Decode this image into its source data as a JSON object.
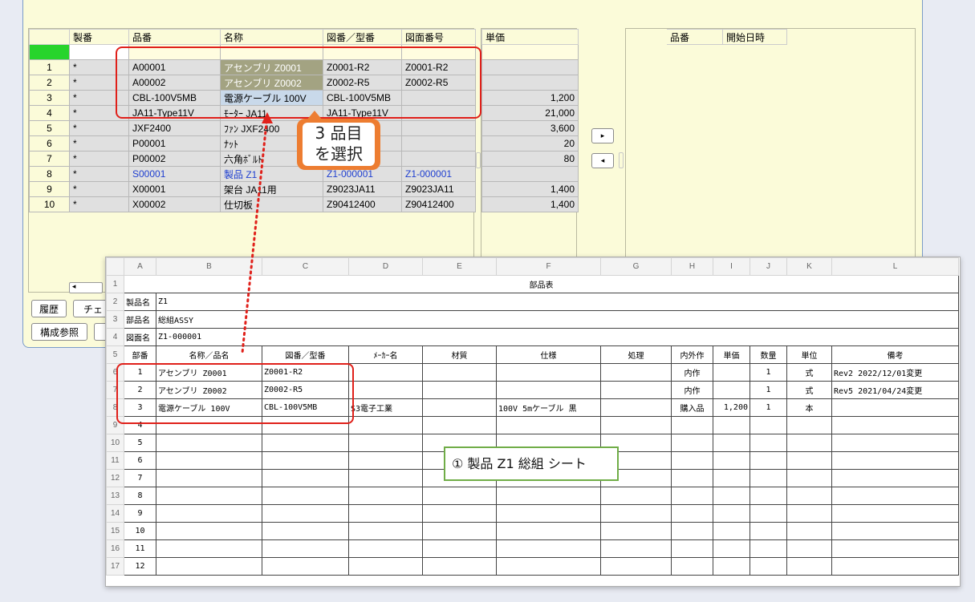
{
  "app": {
    "left_headers": [
      "製番",
      "品番",
      "名称",
      "図番／型番",
      "図面番号"
    ],
    "price_header": "単価",
    "right_headers": [
      "品番",
      "開始日時"
    ],
    "rows": [
      {
        "no": "1",
        "mark": "*",
        "code": "A00001",
        "name": "アセンブリ Z0001",
        "drawing": "Z0001-R2",
        "fig": "Z0001-R2",
        "price": ""
      },
      {
        "no": "2",
        "mark": "*",
        "code": "A00002",
        "name": "アセンブリ Z0002",
        "drawing": "Z0002-R5",
        "fig": "Z0002-R5",
        "price": ""
      },
      {
        "no": "3",
        "mark": "*",
        "code": "CBL-100V5MB",
        "name": "電源ケーブル 100V",
        "drawing": "CBL-100V5MB",
        "fig": "",
        "price": "1,200"
      },
      {
        "no": "4",
        "mark": "*",
        "code": "JA11-Type11V",
        "name": "ﾓｰﾀｰ JA11",
        "drawing": "JA11-Type11V",
        "fig": "",
        "price": "21,000"
      },
      {
        "no": "5",
        "mark": "*",
        "code": "JXF2400",
        "name": "ﾌｧﾝ JXF2400",
        "drawing": "",
        "fig": "",
        "price": "3,600"
      },
      {
        "no": "6",
        "mark": "*",
        "code": "P00001",
        "name": "ﾅｯﾄ",
        "drawing": "",
        "fig": "",
        "price": "20"
      },
      {
        "no": "7",
        "mark": "*",
        "code": "P00002",
        "name": "六角ﾎﾞﾙﾄ",
        "drawing": "",
        "fig": "",
        "price": "80"
      },
      {
        "no": "8",
        "mark": "*",
        "code": "S00001",
        "name": "製品 Z1",
        "drawing": "Z1-000001",
        "fig": "Z1-000001",
        "price": ""
      },
      {
        "no": "9",
        "mark": "*",
        "code": "X00001",
        "name": "架台 JA11用",
        "drawing": "Z9023JA11",
        "fig": "Z9023JA11",
        "price": "1,400"
      },
      {
        "no": "10",
        "mark": "*",
        "code": "X00002",
        "name": "仕切板",
        "drawing": "Z90412400",
        "fig": "Z90412400",
        "price": "1,400"
      }
    ],
    "buttons": {
      "move_right": "▸",
      "move_left": "◂",
      "history": "履歴",
      "check": "チェ",
      "structure_ref": "構成参照"
    },
    "callout": {
      "line1": "3 品目",
      "line2": "を選択"
    }
  },
  "sheet": {
    "col_headers": [
      "A",
      "B",
      "C",
      "D",
      "E",
      "F",
      "G",
      "H",
      "I",
      "J",
      "K",
      "L"
    ],
    "title": "部品表",
    "info": [
      {
        "label": "製品名",
        "value": "Z1"
      },
      {
        "label": "部品名",
        "value": "総組ASSY"
      },
      {
        "label": "図面名",
        "value": "Z1-000001"
      }
    ],
    "table_headers": [
      "部番",
      "名称／品名",
      "図番／型番",
      "ﾒｰｶｰ名",
      "材質",
      "仕様",
      "処理",
      "内外作",
      "単価",
      "数量",
      "単位",
      "備考"
    ],
    "rows": [
      {
        "rownum": "6",
        "no": "1",
        "name": "アセンブリ Z0001",
        "drawing": "Z0001-R2",
        "maker": "",
        "material": "",
        "spec": "",
        "process": "",
        "inout": "内作",
        "price": "",
        "qty": "1",
        "unit": "式",
        "note": "Rev2 2022/12/01変更"
      },
      {
        "rownum": "7",
        "no": "2",
        "name": "アセンブリ Z0002",
        "drawing": "Z0002-R5",
        "maker": "",
        "material": "",
        "spec": "",
        "process": "",
        "inout": "内作",
        "price": "",
        "qty": "1",
        "unit": "式",
        "note": "Rev5 2021/04/24変更"
      },
      {
        "rownum": "8",
        "no": "3",
        "name": "電源ケーブル 100V",
        "drawing": "CBL-100V5MB",
        "maker": "S3電子工業",
        "material": "",
        "spec": "100V 5mケーブル 黒",
        "process": "",
        "inout": "購入品",
        "price": "1,200",
        "qty": "1",
        "unit": "本",
        "note": ""
      },
      {
        "rownum": "9",
        "no": "4"
      },
      {
        "rownum": "10",
        "no": "5"
      },
      {
        "rownum": "11",
        "no": "6"
      },
      {
        "rownum": "12",
        "no": "7"
      },
      {
        "rownum": "13",
        "no": "8"
      },
      {
        "rownum": "14",
        "no": "9"
      },
      {
        "rownum": "15",
        "no": "10"
      },
      {
        "rownum": "16",
        "no": "11"
      },
      {
        "rownum": "17",
        "no": "12"
      }
    ],
    "label": "① 製品 Z1 総組 シート"
  },
  "colors": {
    "highlight_red": "#e0201a",
    "callout_orange": "#ed7d31",
    "label_green": "#70ad47",
    "panel_yellow": "#fbfbd9"
  }
}
